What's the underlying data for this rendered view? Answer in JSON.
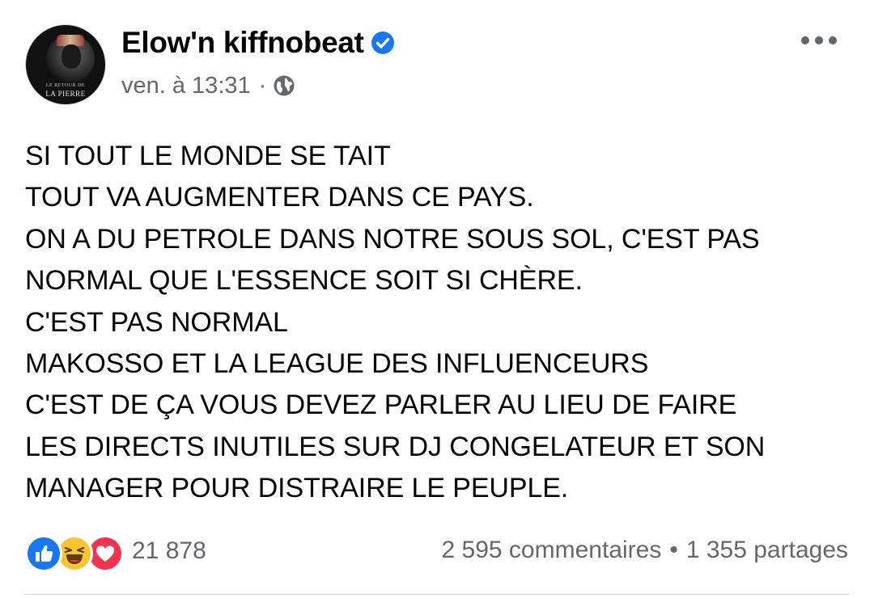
{
  "post": {
    "author": "Elow'n kiffnobeat",
    "timestamp": "ven. à 13:31",
    "meta_separator": "·",
    "avatar_caption_small": "LE RETOUR DE",
    "avatar_caption": "LA PIERRE",
    "verified": true,
    "privacy_icon": "globe-icon",
    "lines": [
      "SI TOUT LE MONDE SE TAIT",
      "TOUT VA AUGMENTER DANS CE PAYS.",
      "ON A DU PETROLE DANS NOTRE SOUS SOL, C'EST PAS",
      "NORMAL QUE L'ESSENCE SOIT SI CHÈRE.",
      "C'EST PAS NORMAL",
      "MAKOSSO ET LA LEAGUE DES INFLUENCEURS",
      "C'EST DE ÇA VOUS DEVEZ PARLER AU LIEU DE FAIRE",
      "LES DIRECTS INUTILES SUR DJ CONGELATEUR ET SON",
      "MANAGER POUR DISTRAIRE LE PEUPLE."
    ]
  },
  "footer": {
    "reactions": [
      "like-icon",
      "haha-icon",
      "love-icon"
    ],
    "reaction_count": "21 878",
    "comments": "2 595 commentaires",
    "stats_separator": "•",
    "shares": "1 355 partages"
  },
  "colors": {
    "verified": "#1877f2",
    "secondary_text": "#65676b",
    "like": "#1877f2",
    "haha": "#f7c533",
    "love": "#f0344f"
  }
}
